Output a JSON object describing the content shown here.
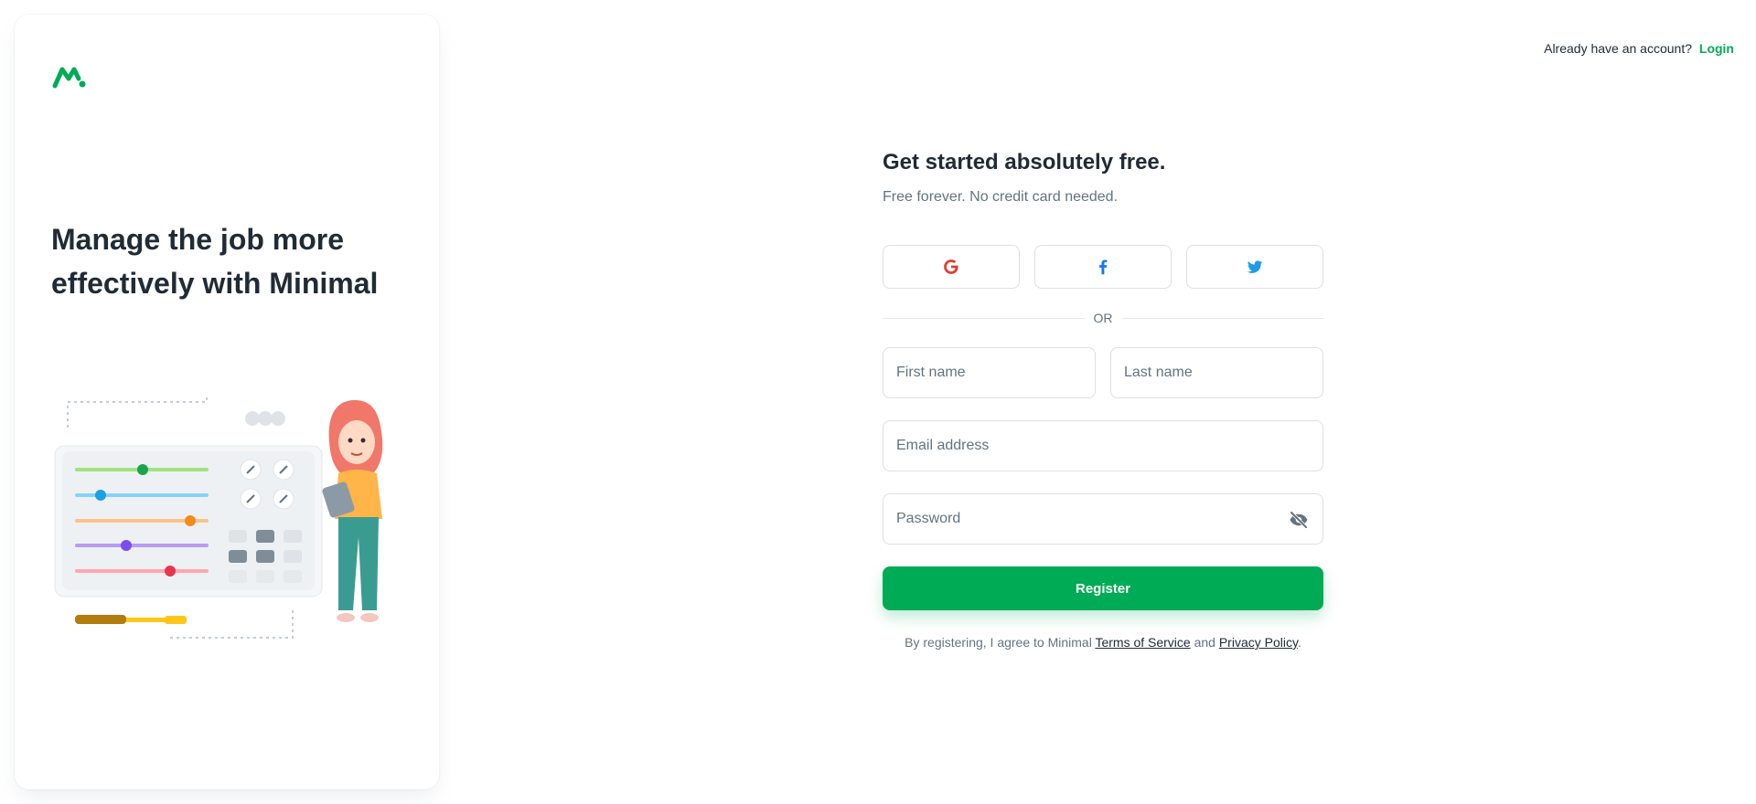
{
  "brand": {
    "logo_icon": "minimal-logo-icon",
    "accent": "#00ab55"
  },
  "side": {
    "title": "Manage the job more effectively with Minimal"
  },
  "header": {
    "prompt": "Already have an account?",
    "login_label": "Login"
  },
  "form": {
    "title": "Get started absolutely free.",
    "subtitle": "Free forever. No credit card needed.",
    "social": [
      "google-icon",
      "facebook-icon",
      "twitter-icon"
    ],
    "divider": "OR",
    "first_name_placeholder": "First name",
    "last_name_placeholder": "Last name",
    "email_placeholder": "Email address",
    "password_placeholder": "Password",
    "register_label": "Register",
    "terms_prefix": "By registering, I agree to Minimal ",
    "terms_link": "Terms of Service",
    "terms_and": " and ",
    "privacy_link": "Privacy Policy",
    "terms_suffix": "."
  }
}
